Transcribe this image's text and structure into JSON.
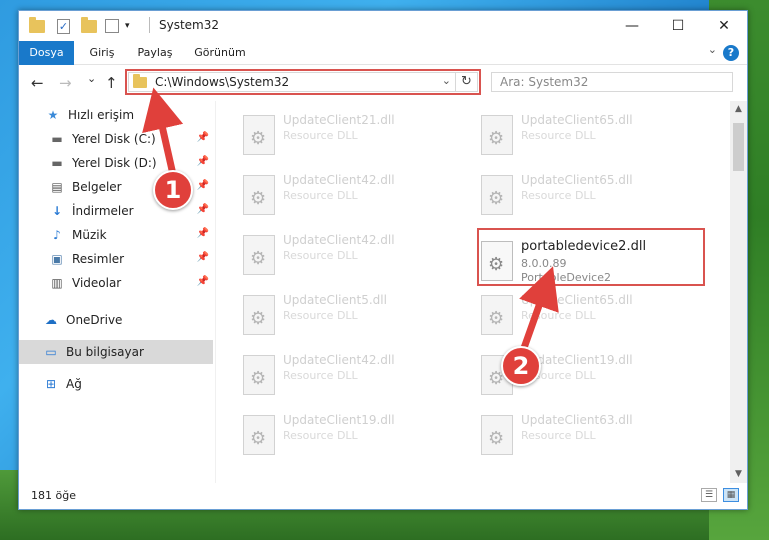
{
  "window": {
    "title": "System32",
    "minimize": "—",
    "maximize": "☐",
    "close": "✕"
  },
  "ribbon": {
    "tabs": [
      "Dosya",
      "Giriş",
      "Paylaş",
      "Görünüm"
    ],
    "help": "?"
  },
  "nav": {
    "back": "←",
    "forward": "→",
    "recent": "⌄",
    "up": "↑",
    "address": "C:\\Windows\\System32",
    "search_placeholder": "Ara: System32"
  },
  "sidebar": {
    "items": [
      {
        "label": "Hızlı erişim",
        "icon": "star-icon"
      },
      {
        "label": "Yerel Disk (C:)",
        "icon": "drive-icon",
        "pinned": true
      },
      {
        "label": "Yerel Disk (D:)",
        "icon": "drive-icon",
        "pinned": true
      },
      {
        "label": "Belgeler",
        "icon": "document-icon",
        "pinned": true
      },
      {
        "label": "İndirmeler",
        "icon": "download-icon",
        "pinned": true
      },
      {
        "label": "Müzik",
        "icon": "music-icon",
        "pinned": true
      },
      {
        "label": "Resimler",
        "icon": "image-icon",
        "pinned": true
      },
      {
        "label": "Videolar",
        "icon": "video-icon",
        "pinned": true
      },
      {
        "label": "OneDrive",
        "icon": "cloud-icon"
      },
      {
        "label": "Bu bilgisayar",
        "icon": "computer-icon",
        "selected": true
      },
      {
        "label": "Ağ",
        "icon": "network-icon"
      }
    ]
  },
  "files": [
    {
      "name": "UpdateClient21.dll",
      "type": "Resource DLL"
    },
    {
      "name": "UpdateClient65.dll",
      "type": "Resource DLL"
    },
    {
      "name": "UpdateClient42.dll",
      "type": "Resource DLL"
    },
    {
      "name": "UpdateClient65.dll",
      "type": "Resource DLL"
    },
    {
      "name": "UpdateClient42.dll",
      "type": "Resource DLL"
    },
    {
      "name": "portabledevice2.dll",
      "version": "8.0.0.89",
      "type": "PortableDevice2",
      "focus": true
    },
    {
      "name": "UpdateClient5.dll",
      "type": "Resource DLL"
    },
    {
      "name": "UpdateClient65.dll",
      "type": "Resource DLL"
    },
    {
      "name": "UpdateClient42.dll",
      "type": "Resource DLL"
    },
    {
      "name": "UpdateClient19.dll",
      "type": "Resource DLL"
    },
    {
      "name": "UpdateClient19.dll",
      "type": "Resource DLL"
    },
    {
      "name": "UpdateClient63.dll",
      "type": "Resource DLL"
    }
  ],
  "status": {
    "count": "181 öğe"
  },
  "callouts": [
    "1",
    "2"
  ],
  "colors": {
    "accent": "#1979ca",
    "highlight": "#d9534f",
    "callout": "#e0403b"
  }
}
